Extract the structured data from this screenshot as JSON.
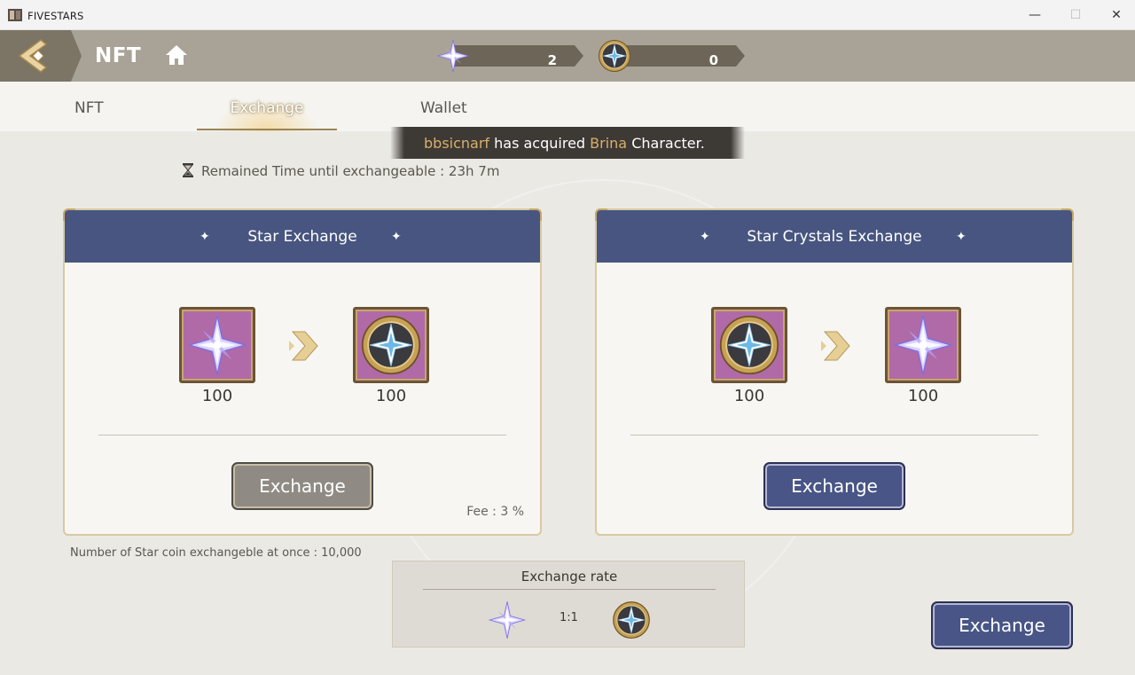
{
  "window": {
    "title": "FIVESTARS",
    "minimize": "—",
    "maximize": "☐",
    "close": "✕"
  },
  "header": {
    "page_title": "NFT",
    "star_balance": "2",
    "coin_balance": "0"
  },
  "tabs": [
    {
      "label": "NFT"
    },
    {
      "label": "Exchange"
    },
    {
      "label": "Wallet"
    }
  ],
  "notice": {
    "user": "bbsicnarf",
    "mid": " has acquired ",
    "item": "Brina",
    "end": " Character."
  },
  "remain_text": "Remained Time until exchangeable : 23h 7m",
  "panels": [
    {
      "title": "Star Exchange",
      "from_icon": "star-crystal-icon",
      "from_qty": "100",
      "to_icon": "star-coin-icon",
      "to_qty": "100",
      "button": "Exchange",
      "fee": "Fee :  3 %"
    },
    {
      "title": "Star Crystals Exchange",
      "from_icon": "star-coin-icon",
      "from_qty": "100",
      "to_icon": "star-crystal-icon",
      "to_qty": "100",
      "button": "Exchange"
    }
  ],
  "max_note": "Number of Star coin exchangeble at once : 10,000",
  "rate": {
    "title": "Exchange rate",
    "ratio": "1:1"
  },
  "main_button": "Exchange",
  "colors": {
    "panel_header": "#475580",
    "button_blue": "#485586",
    "button_gray": "#8f8b84",
    "gold": "#d7b06a",
    "item_bg": "#b06aa8"
  }
}
